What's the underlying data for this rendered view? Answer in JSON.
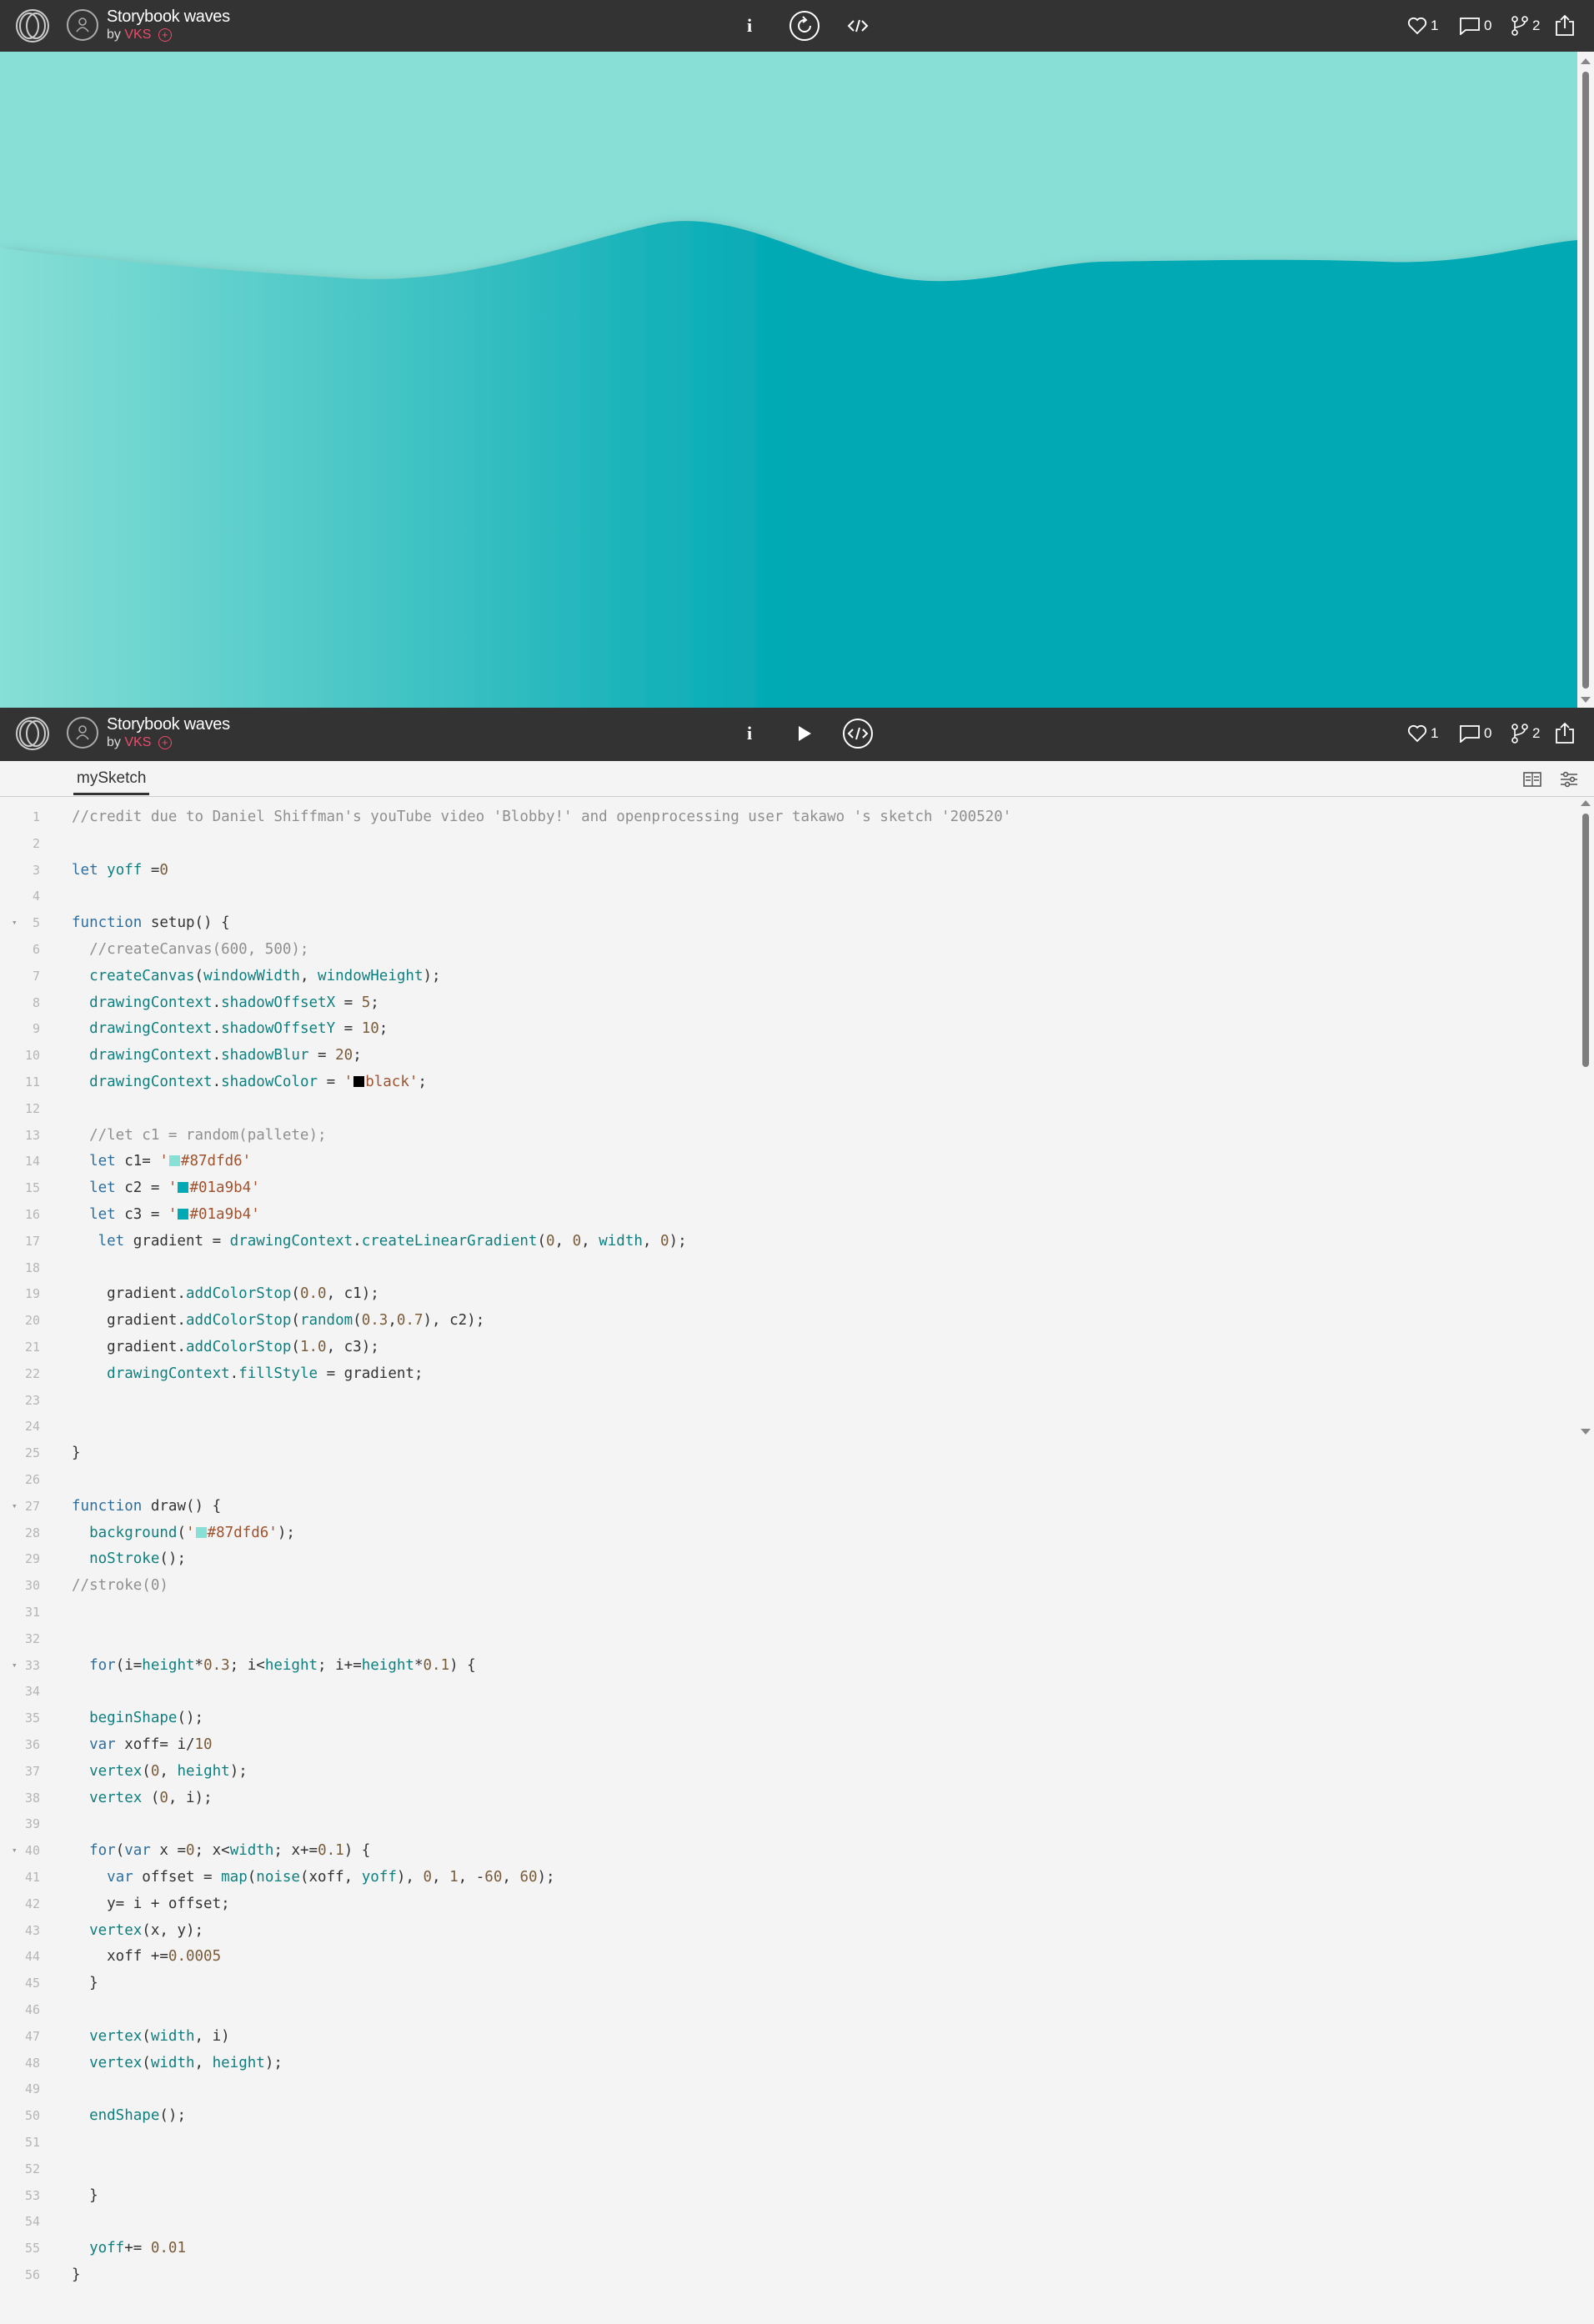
{
  "app": {
    "sketch_title": "Storybook waves",
    "by_label": "by",
    "author": "VKS",
    "author_plus": "+",
    "info_label": "i"
  },
  "stats": {
    "likes": "1",
    "comments": "0",
    "forks": "2"
  },
  "editor": {
    "tab_label": "mySketch"
  },
  "colors": {
    "bar": "#333333",
    "accent": "#ed4b6c",
    "sky": "#87dfd6",
    "wave": "#01a9b4"
  },
  "code_lines": [
    {
      "n": "1",
      "text": "//credit due to Daniel Shiffman's youTube video 'Blobby!' and openprocessing user takawo 's sketch '200520'"
    },
    {
      "n": "2",
      "text": ""
    },
    {
      "n": "3",
      "text": "let yoff =0"
    },
    {
      "n": "4",
      "text": ""
    },
    {
      "n": "5",
      "text": "function setup() {",
      "fold": true
    },
    {
      "n": "6",
      "text": "  //createCanvas(600, 500);"
    },
    {
      "n": "7",
      "text": "  createCanvas(windowWidth, windowHeight);"
    },
    {
      "n": "8",
      "text": "  drawingContext.shadowOffsetX = 5;"
    },
    {
      "n": "9",
      "text": "  drawingContext.shadowOffsetY = 10;"
    },
    {
      "n": "10",
      "text": "  drawingContext.shadowBlur = 20;"
    },
    {
      "n": "11",
      "text": "  drawingContext.shadowColor = '■black';"
    },
    {
      "n": "12",
      "text": ""
    },
    {
      "n": "13",
      "text": "  //let c1 = random(pallete);"
    },
    {
      "n": "14",
      "text": "  let c1= '■#87dfd6'"
    },
    {
      "n": "15",
      "text": "  let c2 = '■#01a9b4'"
    },
    {
      "n": "16",
      "text": "  let c3 = '■#01a9b4'"
    },
    {
      "n": "17",
      "text": "   let gradient = drawingContext.createLinearGradient(0, 0, width, 0);"
    },
    {
      "n": "18",
      "text": ""
    },
    {
      "n": "19",
      "text": "    gradient.addColorStop(0.0, c1);"
    },
    {
      "n": "20",
      "text": "    gradient.addColorStop(random(0.3,0.7), c2);"
    },
    {
      "n": "21",
      "text": "    gradient.addColorStop(1.0, c3);"
    },
    {
      "n": "22",
      "text": "    drawingContext.fillStyle = gradient;"
    },
    {
      "n": "23",
      "text": ""
    },
    {
      "n": "24",
      "text": ""
    },
    {
      "n": "25",
      "text": "}"
    },
    {
      "n": "26",
      "text": ""
    },
    {
      "n": "27",
      "text": "function draw() {",
      "fold": true
    },
    {
      "n": "28",
      "text": "  background('■#87dfd6');"
    },
    {
      "n": "29",
      "text": "  noStroke();"
    },
    {
      "n": "30",
      "text": "//stroke(0)"
    },
    {
      "n": "31",
      "text": ""
    },
    {
      "n": "32",
      "text": ""
    },
    {
      "n": "33",
      "text": "  for(i=height*0.3; i<height; i+=height*0.1) {",
      "fold": true
    },
    {
      "n": "34",
      "text": ""
    },
    {
      "n": "35",
      "text": "  beginShape();"
    },
    {
      "n": "36",
      "text": "  var xoff= i/10"
    },
    {
      "n": "37",
      "text": "  vertex(0, height);"
    },
    {
      "n": "38",
      "text": "  vertex (0, i);"
    },
    {
      "n": "39",
      "text": ""
    },
    {
      "n": "40",
      "text": "  for(var x =0; x<width; x+=0.1) {",
      "fold": true
    },
    {
      "n": "41",
      "text": "    var offset = map(noise(xoff, yoff), 0, 1, -60, 60);"
    },
    {
      "n": "42",
      "text": "    y= i + offset;"
    },
    {
      "n": "43",
      "text": "  vertex(x, y);"
    },
    {
      "n": "44",
      "text": "    xoff +=0.0005"
    },
    {
      "n": "45",
      "text": "  }"
    },
    {
      "n": "46",
      "text": ""
    },
    {
      "n": "47",
      "text": "  vertex(width, i)"
    },
    {
      "n": "48",
      "text": "  vertex(width, height);"
    },
    {
      "n": "49",
      "text": ""
    },
    {
      "n": "50",
      "text": "  endShape();"
    },
    {
      "n": "51",
      "text": ""
    },
    {
      "n": "52",
      "text": ""
    },
    {
      "n": "53",
      "text": "  }"
    },
    {
      "n": "54",
      "text": ""
    },
    {
      "n": "55",
      "text": "  yoff+= 0.01"
    },
    {
      "n": "56",
      "text": "}"
    }
  ]
}
